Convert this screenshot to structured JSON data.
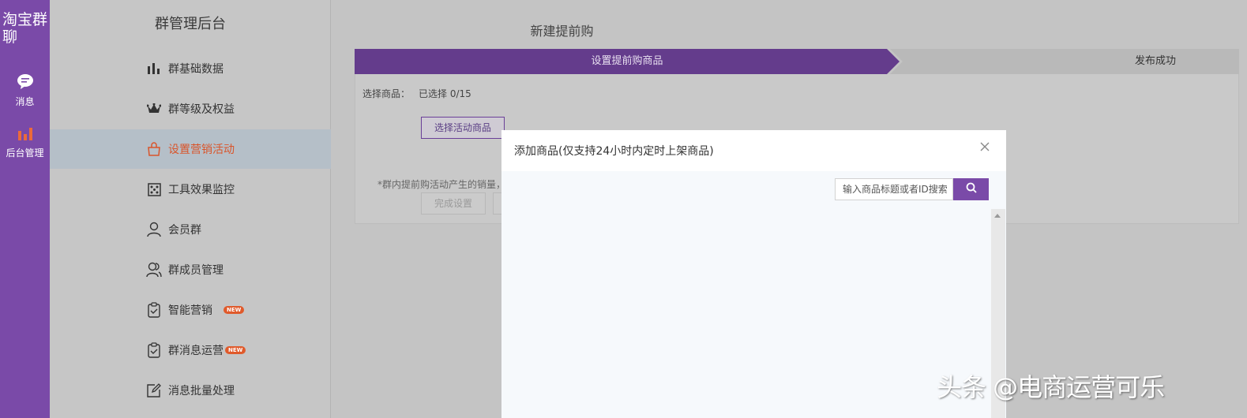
{
  "rail": {
    "brand": "淘宝群聊",
    "items": [
      {
        "label": "消息",
        "icon": "chat-bubble-icon"
      },
      {
        "label": "后台管理",
        "icon": "bar-chart-icon"
      }
    ]
  },
  "sidebar": {
    "title": "群管理后台",
    "items": [
      {
        "label": "群基础数据",
        "icon": "bar-chart-icon"
      },
      {
        "label": "群等级及权益",
        "icon": "crown-icon"
      },
      {
        "label": "设置营销活动",
        "icon": "shopping-bag-icon"
      },
      {
        "label": "工具效果监控",
        "icon": "monitor-icon"
      },
      {
        "label": "会员群",
        "icon": "user-icon"
      },
      {
        "label": "群成员管理",
        "icon": "users-icon"
      },
      {
        "label": "智能营销",
        "icon": "clipboard-icon",
        "badge": "NEW"
      },
      {
        "label": "群消息运营",
        "icon": "clipboard-icon",
        "badge": "NEW"
      },
      {
        "label": "消息批量处理",
        "icon": "edit-icon"
      }
    ]
  },
  "main": {
    "page_title": "新建提前购",
    "steps": [
      "设置提前购商品",
      "发布成功"
    ],
    "select_label": "选择商品：",
    "select_count": "已选择  0/15",
    "choose_button": "选择活动商品",
    "note": "*群内提前购活动产生的销量，",
    "done_button": "完成设置"
  },
  "modal": {
    "title": "添加商品(仅支持24小时内定时上架商品)",
    "search_placeholder": "输入商品标题或者ID搜索"
  },
  "watermark": "头条 @电商运营可乐",
  "colors": {
    "accent": "#7a4aa8",
    "step_active": "#643c8c",
    "active_text": "#d9552b"
  }
}
